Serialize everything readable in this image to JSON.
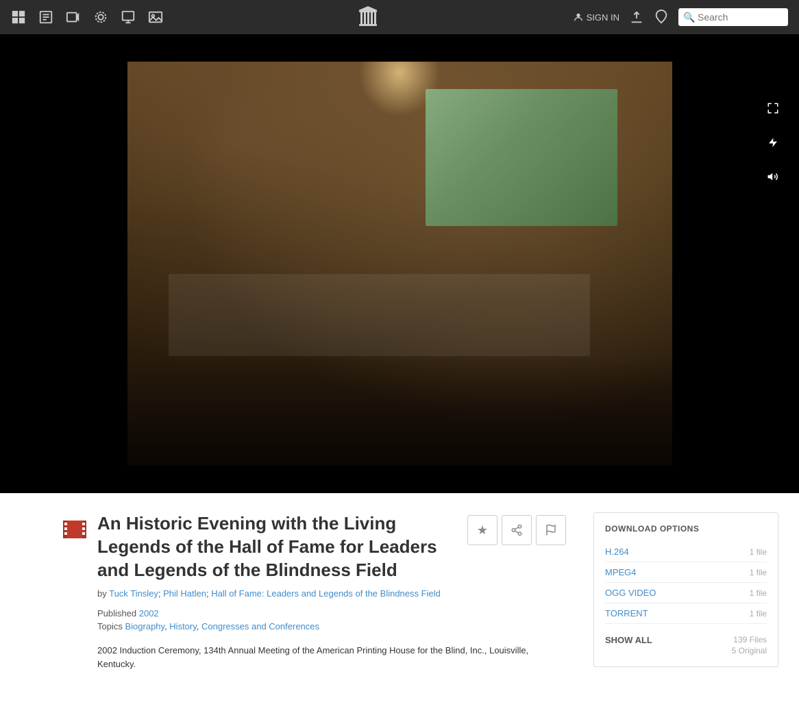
{
  "navbar": {
    "sign_in_label": "SIGN IN",
    "search_placeholder": "Search"
  },
  "video": {
    "controls": {
      "fullscreen_icon": "⤢",
      "flash_icon": "⚡",
      "volume_icon": "🔊"
    }
  },
  "item": {
    "film_icon_color": "#c0392b",
    "title": "An Historic Evening with the Living Legends of the Hall of Fame for Leaders and Legends of the Blindness Field",
    "authors": [
      {
        "name": "Tuck Tinsley",
        "url": "#"
      },
      {
        "name": "Phil Hatlen",
        "url": "#"
      },
      {
        "name": "Hall of Fame: Leaders and Legends of the Blindness Field",
        "url": "#"
      }
    ],
    "authors_display": "by Tuck Tinsley; Phil Hatlen; Hall of Fame: Leaders and Legends of the Blindness Field",
    "published_label": "Published",
    "published_year": "2002",
    "topics_label": "Topics",
    "topics": [
      {
        "name": "Biography",
        "url": "#"
      },
      {
        "name": "History",
        "url": "#"
      },
      {
        "name": "Congresses and Conferences",
        "url": "#"
      }
    ],
    "description": "2002 Induction Ceremony, 134th Annual Meeting of the American Printing House for the Blind, Inc., Louisville, Kentucky."
  },
  "download": {
    "section_title": "DOWNLOAD OPTIONS",
    "options": [
      {
        "label": "H.264",
        "count": "1 file"
      },
      {
        "label": "MPEG4",
        "count": "1 file"
      },
      {
        "label": "OGG VIDEO",
        "count": "1 file"
      },
      {
        "label": "TORRENT",
        "count": "1 file"
      }
    ],
    "show_all_label": "SHOW ALL",
    "total_files": "139 Files",
    "original_files": "5 Original"
  },
  "actions": {
    "favorite_icon": "★",
    "share_icon": "↗",
    "flag_icon": "⚑"
  }
}
